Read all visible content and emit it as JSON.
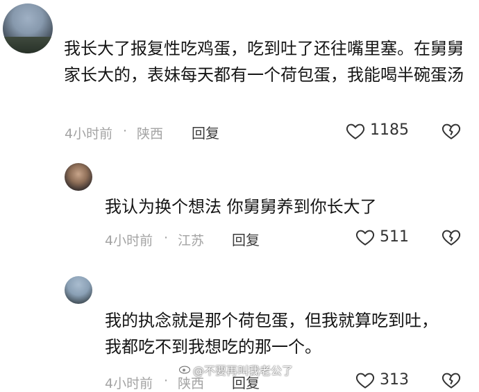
{
  "comments": [
    {
      "text": "我长大了报复性吃鸡蛋，吃到吐了还往嘴里塞。在舅舅家长大的，表妹每天都有一个荷包蛋，我能喝半碗蛋汤",
      "time": "4小时前",
      "location": "陕西",
      "reply_label": "回复",
      "likes": "1185"
    },
    {
      "text": "我认为换个想法 你舅舅养到你长大了",
      "time": "4小时前",
      "location": "江苏",
      "reply_label": "回复",
      "likes": "511"
    },
    {
      "text": "我的执念就是那个荷包蛋，但我就算吃到吐，我都吃不到我想吃的那一个。",
      "time": "4小时前",
      "location": "陕西",
      "reply_label": "回复",
      "likes": "313"
    }
  ],
  "meta_separator": "·",
  "watermark": "@不要再叫我老公了",
  "icons": {
    "like": "heart-outline-icon",
    "dislike": "broken-heart-icon",
    "watermark": "weibo-logo-icon"
  }
}
